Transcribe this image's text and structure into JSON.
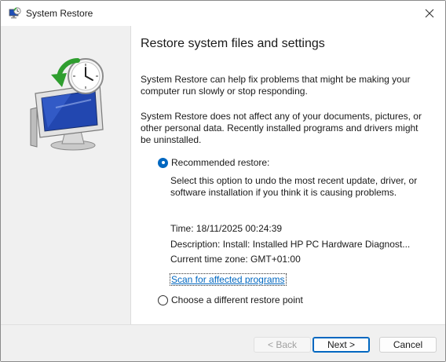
{
  "window": {
    "title": "System Restore",
    "app_icon": "system-restore-icon",
    "close_icon": "close-icon"
  },
  "side_panel": {
    "illustration": "monitor-with-clock-restore-icon"
  },
  "main": {
    "heading": "Restore system files and settings",
    "paragraph1": "System Restore can help fix problems that might be making your computer run slowly or stop responding.",
    "paragraph2": "System Restore does not affect any of your documents, pictures, or other personal data. Recently installed programs and drivers might be uninstalled.",
    "options": {
      "recommended": {
        "label": "Recommended restore:",
        "selected": true,
        "description": "Select this option to undo the most recent update, driver, or software installation if you think it is causing problems.",
        "time": "Time: 18/11/2025 00:24:39",
        "description_line": "Description: Install: Installed HP PC Hardware Diagnost...",
        "timezone": "Current time zone: GMT+01:00",
        "scan_link": "Scan for affected programs"
      },
      "different": {
        "label": "Choose a different restore point",
        "selected": false
      }
    }
  },
  "footer": {
    "back_label": "< Back",
    "next_label": "Next >",
    "cancel_label": "Cancel",
    "back_enabled": false
  },
  "colors": {
    "accent": "#0067c0",
    "side_panel_bg": "#f0f0f0"
  }
}
